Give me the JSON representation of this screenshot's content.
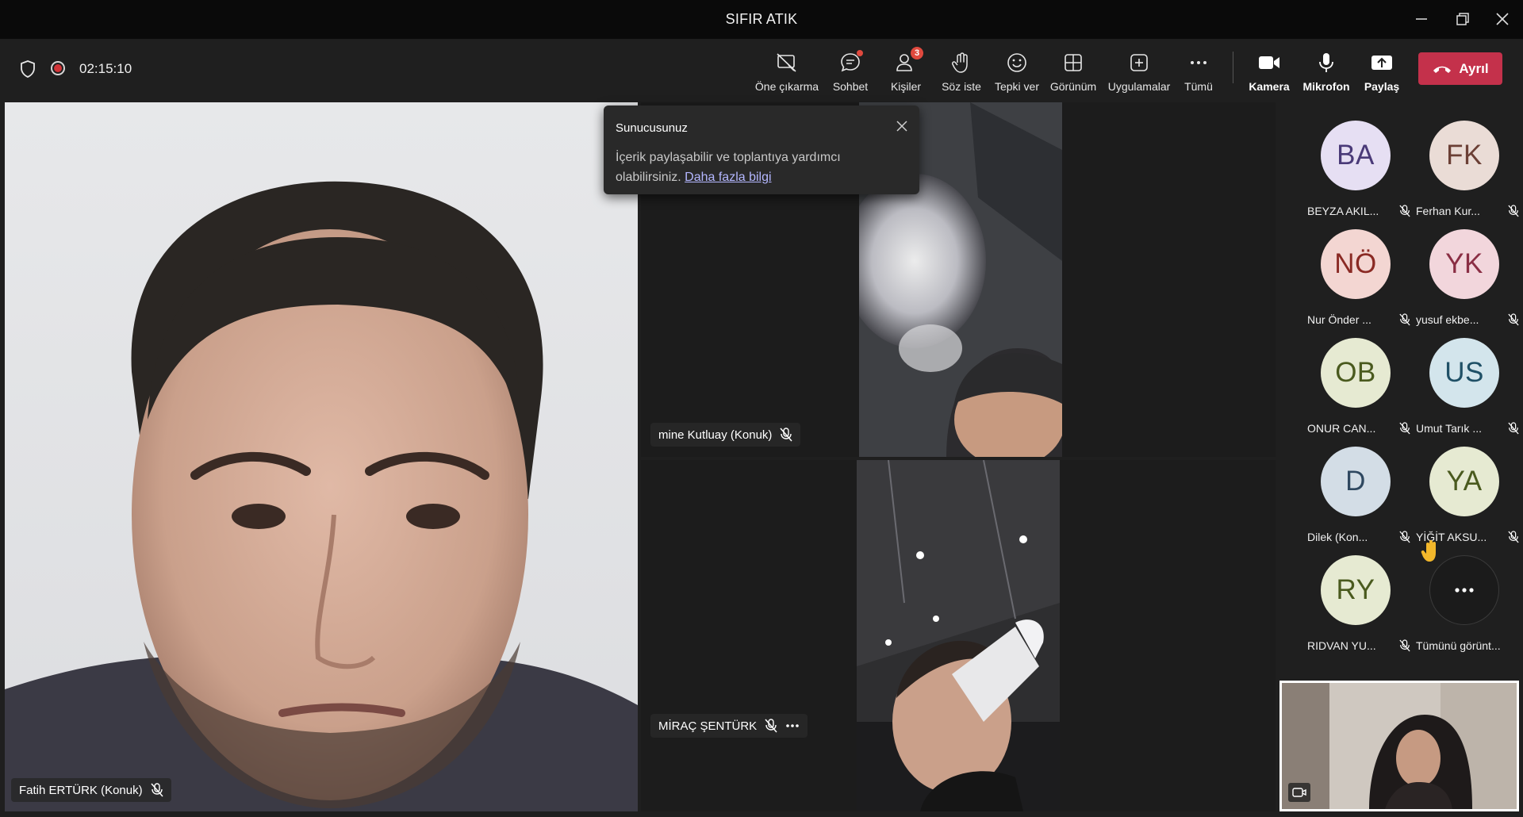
{
  "window": {
    "title": "SIFIR ATIK"
  },
  "meeting": {
    "timer": "02:15:10"
  },
  "toolbar": {
    "spotlight": "Öne çıkarma",
    "chat": "Sohbet",
    "people": "Kişiler",
    "people_count": "3",
    "raise_hand": "Söz iste",
    "react": "Tepki ver",
    "view": "Görünüm",
    "apps": "Uygulamalar",
    "more": "Tümü",
    "camera": "Kamera",
    "mic": "Mikrofon",
    "share": "Paylaş",
    "leave": "Ayrıl"
  },
  "popover": {
    "title": "Sunucusunuz",
    "body": "İçerik paylaşabilir ve toplantıya yardımcı olabilirsiniz.",
    "link": "Daha fazla bilgi"
  },
  "tiles": {
    "main_name": "Fatih ERTÜRK (Konuk)",
    "top_name": "mine Kutluay (Konuk)",
    "bottom_name": "MİRAÇ ŞENTÜRK"
  },
  "roster": [
    {
      "initials": "BA",
      "name": "BEYZA AKIL...",
      "bg": "#e6dff3",
      "fg": "#4a3a78"
    },
    {
      "initials": "FK",
      "name": "Ferhan Kur...",
      "bg": "#eadcd6",
      "fg": "#6b3f35"
    },
    {
      "initials": "NÖ",
      "name": "Nur Önder ...",
      "bg": "#f3d6d2",
      "fg": "#8a2a24"
    },
    {
      "initials": "YK",
      "name": "yusuf ekbe...",
      "bg": "#f2d6dc",
      "fg": "#8a2e44"
    },
    {
      "initials": "OB",
      "name": "ONUR CAN...",
      "bg": "#e6ead2",
      "fg": "#4a5a1e"
    },
    {
      "initials": "US",
      "name": "Umut Tarık ...",
      "bg": "#d3e5ec",
      "fg": "#1f5066"
    },
    {
      "initials": "D",
      "name": "Dilek (Kon...",
      "bg": "#d3dde6",
      "fg": "#2f4860"
    },
    {
      "initials": "YA",
      "name": "YİĞİT AKSU...",
      "bg": "#e6ead2",
      "fg": "#4a5a1e"
    },
    {
      "initials": "RY",
      "name": "RIDVAN YU...",
      "bg": "#e6ead2",
      "fg": "#4a5a1e"
    }
  ],
  "roster_more": {
    "label": "Tümünü görünt..."
  },
  "icons": {
    "shield": "shield-icon",
    "record": "record-icon",
    "mic_off": "mic-off-icon",
    "raised_hand": "raised-hand-icon"
  }
}
